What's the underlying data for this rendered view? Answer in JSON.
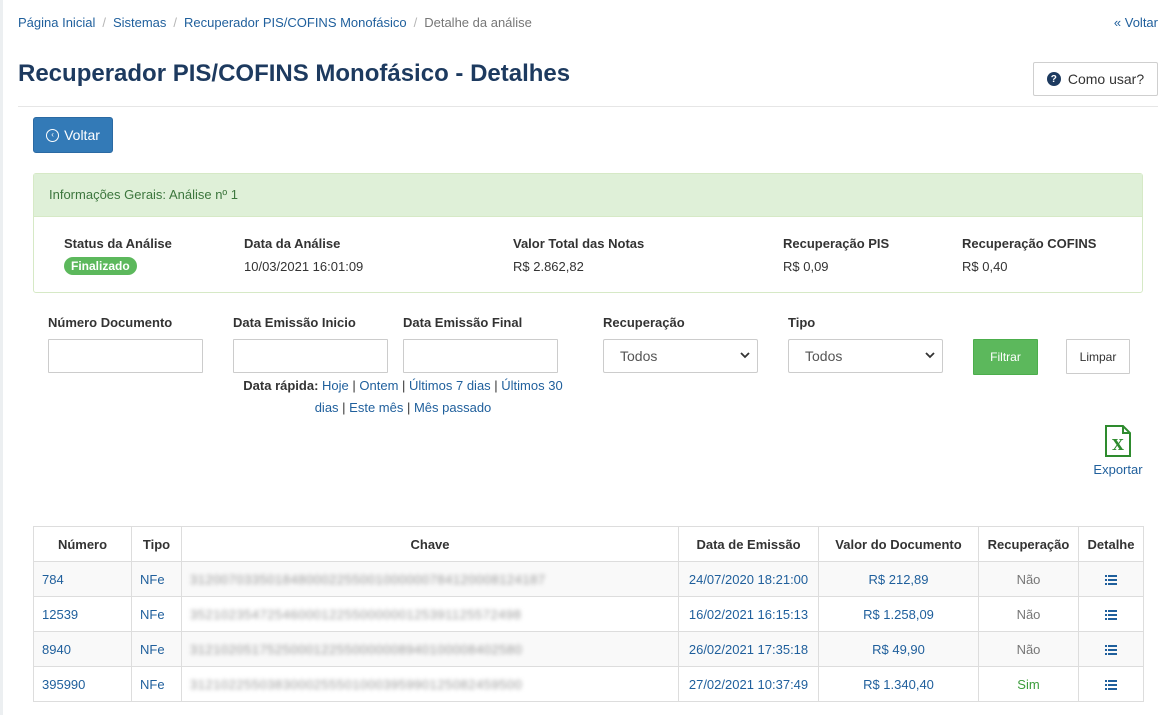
{
  "breadcrumb": {
    "items": [
      "Página Inicial",
      "Sistemas",
      "Recuperador PIS/COFINS Monofásico"
    ],
    "current": "Detalhe da análise",
    "back_label": "Voltar"
  },
  "header": {
    "title": "Recuperador PIS/COFINS Monofásico - Detalhes",
    "help_label": "Como usar?"
  },
  "actions": {
    "back_label": "Voltar"
  },
  "info_panel": {
    "heading": "Informações Gerais: Análise nº 1",
    "status_label": "Status da Análise",
    "status_value": "Finalizado",
    "date_label": "Data da Análise",
    "date_value": "10/03/2021 16:01:09",
    "total_label": "Valor Total das Notas",
    "total_value": "R$ 2.862,82",
    "pis_label": "Recuperação PIS",
    "pis_value": "R$ 0,09",
    "cofins_label": "Recuperação COFINS",
    "cofins_value": "R$ 0,40"
  },
  "filters": {
    "numero_label": "Número Documento",
    "numero_value": "",
    "data_inicio_label": "Data Emissão Inicio",
    "data_inicio_value": "",
    "data_final_label": "Data Emissão Final",
    "data_final_value": "",
    "recuperacao_label": "Recuperação",
    "recuperacao_value": "Todos",
    "tipo_label": "Tipo",
    "tipo_value": "Todos",
    "filter_label": "Filtrar",
    "clear_label": "Limpar",
    "quick_label": "Data rápida:",
    "quick_links": [
      "Hoje",
      "Ontem",
      "Últimos 7 dias",
      "Últimos 30 dias",
      "Este mês",
      "Mês passado"
    ]
  },
  "export": {
    "label": "Exportar",
    "icon": "excel-file-icon"
  },
  "table": {
    "headers": [
      "Número",
      "Tipo",
      "Chave",
      "Data de Emissão",
      "Valor do Documento",
      "Recuperação",
      "Detalhe"
    ],
    "rows": [
      {
        "numero": "784",
        "tipo": "NFe",
        "data": "24/07/2020 18:21:00",
        "valor": "R$ 212,89",
        "recuperacao": "Não"
      },
      {
        "numero": "12539",
        "tipo": "NFe",
        "data": "16/02/2021 16:15:13",
        "valor": "R$ 1.258,09",
        "recuperacao": "Não"
      },
      {
        "numero": "8940",
        "tipo": "NFe",
        "data": "26/02/2021 17:35:18",
        "valor": "R$ 49,90",
        "recuperacao": "Não"
      },
      {
        "numero": "395990",
        "tipo": "NFe",
        "data": "27/02/2021 10:37:49",
        "valor": "R$ 1.340,40",
        "recuperacao": "Sim"
      }
    ]
  },
  "colors": {
    "primary": "#337ab7",
    "success": "#5cb85c",
    "title": "#1d3a5f",
    "link": "#1f5f9c",
    "panel_heading_bg": "#dff0d8"
  }
}
